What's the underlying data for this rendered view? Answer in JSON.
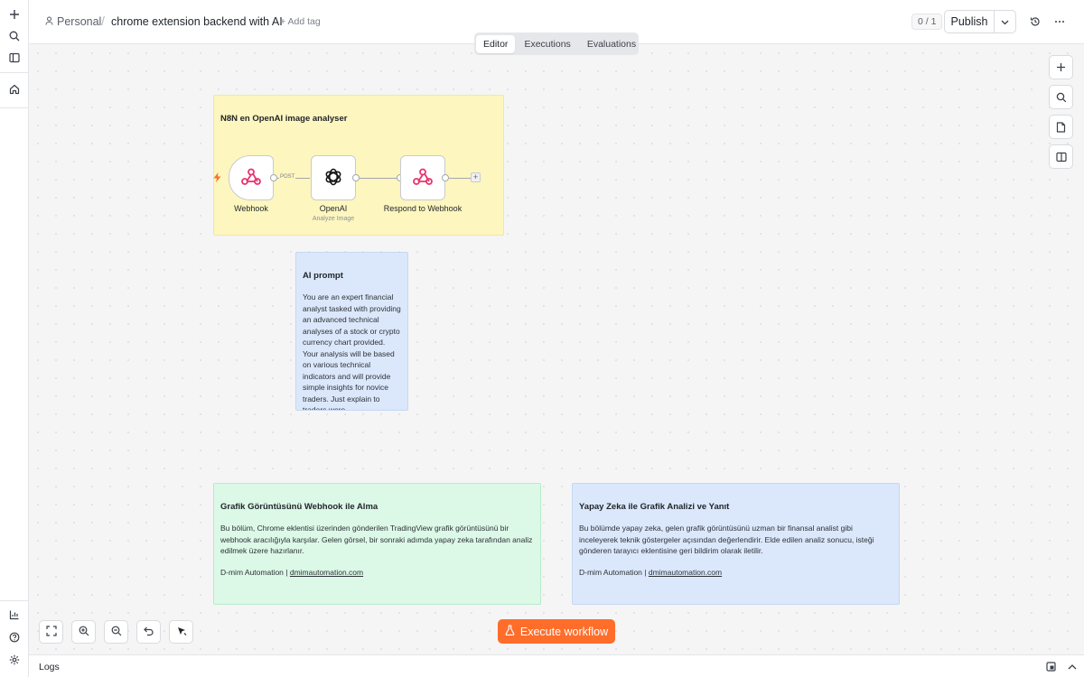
{
  "breadcrumb": {
    "project": "Personal",
    "separator": "/",
    "workflow_name": "chrome extension backend with AI",
    "add_tag": "+ Add tag"
  },
  "header": {
    "counter": "0 / 1",
    "publish_label": "Publish"
  },
  "tabs": [
    {
      "label": "Editor",
      "active": true
    },
    {
      "label": "Executions",
      "active": false
    },
    {
      "label": "Evaluations",
      "active": false
    }
  ],
  "notes": {
    "analyser": {
      "title": "N8N en OpenAI image analyser",
      "color": "#fdf6bf"
    },
    "ai_prompt": {
      "title": "AI prompt",
      "body": "You are an expert financial analyst tasked with providing an advanced technical analyses of a stock or crypto currency chart provided. Your analysis will be based on various technical indicators and will provide simple insights for novice traders. Just explain to traders were",
      "color": "#dbe8fb"
    },
    "webhook_note": {
      "title": "Grafik Görüntüsünü Webhook ile Alma",
      "body": "Bu bölüm, Chrome eklentisi üzerinden gönderilen TradingView grafik görüntüsünü bir webhook aracılığıyla karşılar. Gelen görsel, bir sonraki adımda yapay zeka tarafından analiz edilmek üzere hazırlanır.",
      "sig_prefix": "D-mim Automation |",
      "sig_link": "dmimautomation.com",
      "color": "#dcf8e7"
    },
    "ai_note": {
      "title": "Yapay Zeka ile Grafik Analizi ve Yanıt",
      "body": "Bu bölümde yapay zeka, gelen grafik görüntüsünü uzman bir finansal analist gibi inceleyerek teknik göstergeler açısından değerlendirir. Elde edilen analiz sonucu, isteği gönderen tarayıcı eklentisine geri bildirim olarak iletilir.",
      "sig_prefix": "D-mim Automation |",
      "sig_link": "dmimautomation.com",
      "color": "#dbe8fb"
    }
  },
  "nodes": [
    {
      "name": "Webhook",
      "subtitle": "",
      "icon": "webhook-icon"
    },
    {
      "name": "OpenAI",
      "subtitle": "Analyze Image",
      "icon": "openai-icon"
    },
    {
      "name": "Respond to Webhook",
      "subtitle": "",
      "icon": "webhook-icon"
    }
  ],
  "connection_label": "POST",
  "execute_label": "Execute workflow",
  "logs_label": "Logs",
  "colors": {
    "accent": "#ff6d2a",
    "webhook": "#e8336d"
  }
}
